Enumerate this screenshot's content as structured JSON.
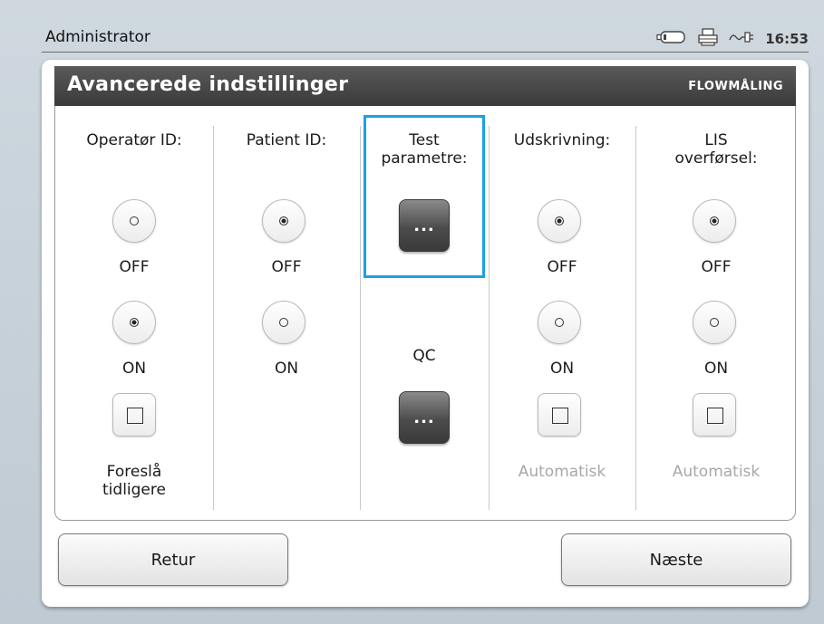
{
  "window": {
    "user": "Administrator",
    "time": "16:53"
  },
  "status_icons": [
    "battery-icon",
    "printer-icon",
    "ac-power-icon"
  ],
  "header": {
    "title": "Avancerede indstillinger",
    "mode": "FLOWMÅLING"
  },
  "columns": {
    "operator": {
      "label": "Operatør ID:",
      "off_label": "OFF",
      "on_label": "ON",
      "selected": "ON",
      "checkbox_label": "Foreslå\ntidligere",
      "checkbox_checked": false
    },
    "patient": {
      "label": "Patient ID:",
      "off_label": "OFF",
      "on_label": "ON",
      "selected": "OFF"
    },
    "test": {
      "label": "Test\nparametre:",
      "button_label": "...",
      "qc_label": "QC",
      "qc_button_label": "..."
    },
    "print": {
      "label": "Udskrivning:",
      "off_label": "OFF",
      "on_label": "ON",
      "selected": "OFF",
      "checkbox_label": "Automatisk",
      "checkbox_checked": false
    },
    "lis": {
      "label": "LIS\noverførsel:",
      "off_label": "OFF",
      "on_label": "ON",
      "selected": "OFF",
      "checkbox_label": "Automatisk",
      "checkbox_checked": false
    }
  },
  "footer": {
    "back_label": "Retur",
    "next_label": "Næste"
  },
  "colors": {
    "header_bg": "#464646",
    "focus": "#1aa0e8",
    "disabled_text": "#a8a8a8"
  }
}
